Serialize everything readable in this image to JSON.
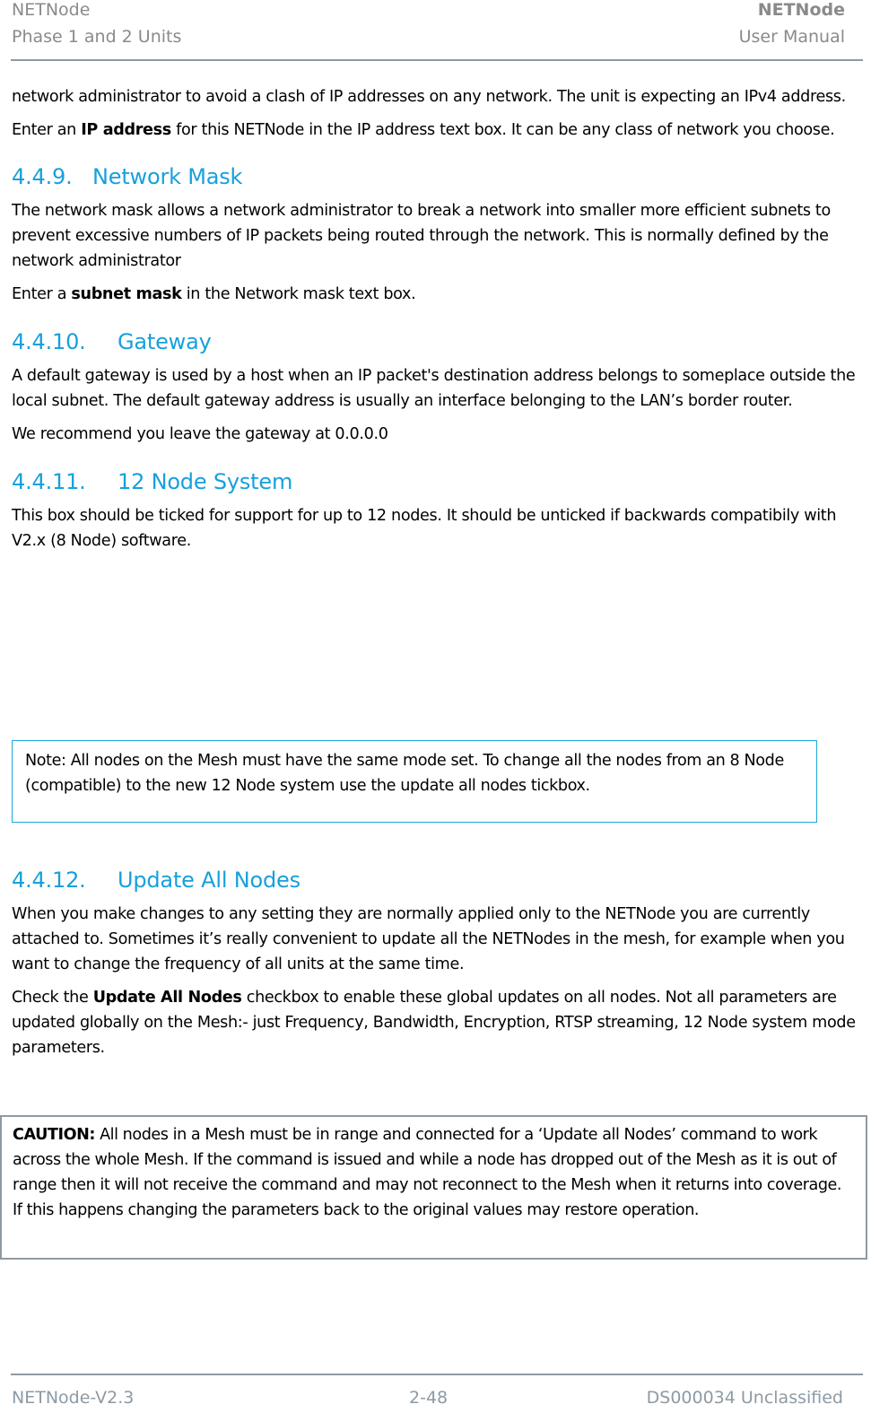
{
  "header": {
    "left_line1": "NETNode",
    "left_line2": "Phase 1 and 2 Units",
    "right_line1": "NETNode",
    "right_line2": "User Manual"
  },
  "intro": {
    "p1": "network administrator to avoid a clash of IP addresses on any network. The unit is expecting an IPv4 address.",
    "p2_pre": "Enter an ",
    "p2_bold": "IP address",
    "p2_post": " for this NETNode in the IP address text box. It can be any class of network you choose."
  },
  "sections": [
    {
      "number": "4.4.9.",
      "title": "Network Mask",
      "p1": "The network mask allows a network administrator to break a network into smaller more efficient subnets to prevent excessive numbers of IP packets being routed through the network. This is normally defined by the network administrator",
      "p2_pre": "Enter a ",
      "p2_bold": "subnet mask",
      "p2_post": " in the Network mask text box."
    },
    {
      "number": "4.4.10.",
      "title": "Gateway",
      "p1": "A default gateway is used by a host when an IP packet's destination address belongs to someplace outside the local subnet. The default gateway address is usually an interface belonging to the LAN’s border router.",
      "p2": "We recommend you leave the gateway at 0.0.0.0"
    },
    {
      "number": "4.4.11.",
      "title": "12 Node System",
      "p1": "This box should be ticked for support for up to 12 nodes. It should be unticked if backwards compatibily with V2.x (8 Node) software."
    },
    {
      "number": "4.4.12.",
      "title": "Update All Nodes",
      "p1": "When you make changes to any setting they are normally applied only to the NETNode you are currently attached to. Sometimes it’s really convenient to update all the NETNodes in the mesh, for example when you want to change the frequency of all units at the same time.",
      "p2_pre": "Check the ",
      "p2_bold": "Update All Nodes",
      "p2_post": " checkbox to enable these global updates on all nodes. Not all parameters are updated globally on the Mesh:- just Frequency, Bandwidth, Encryption, RTSP streaming, 12 Node system mode parameters."
    }
  ],
  "note": {
    "text": "Note: All nodes on the Mesh must have the same mode set. To change all the nodes from an 8 Node (compatible) to the new 12 Node system use the update all nodes tickbox."
  },
  "caution": {
    "label": "CAUTION:",
    "text": " All nodes in a Mesh must be in range and connected for a ‘Update all Nodes’ command to work across the whole Mesh. If the command is issued and while a node has dropped out of the Mesh as it is out of range then it will not receive the command and may not reconnect to the Mesh when it returns into coverage. If this happens changing the parameters back to the original values may restore operation."
  },
  "footer": {
    "left": "NETNode-V2.3",
    "center": "2-48",
    "right": "DS000034 Unclassified"
  },
  "colors": {
    "heading": "#17a0dc",
    "note_border": "#1ba7dd",
    "caution_border": "#8e9aa3",
    "header_text": "#8a8a8a"
  }
}
